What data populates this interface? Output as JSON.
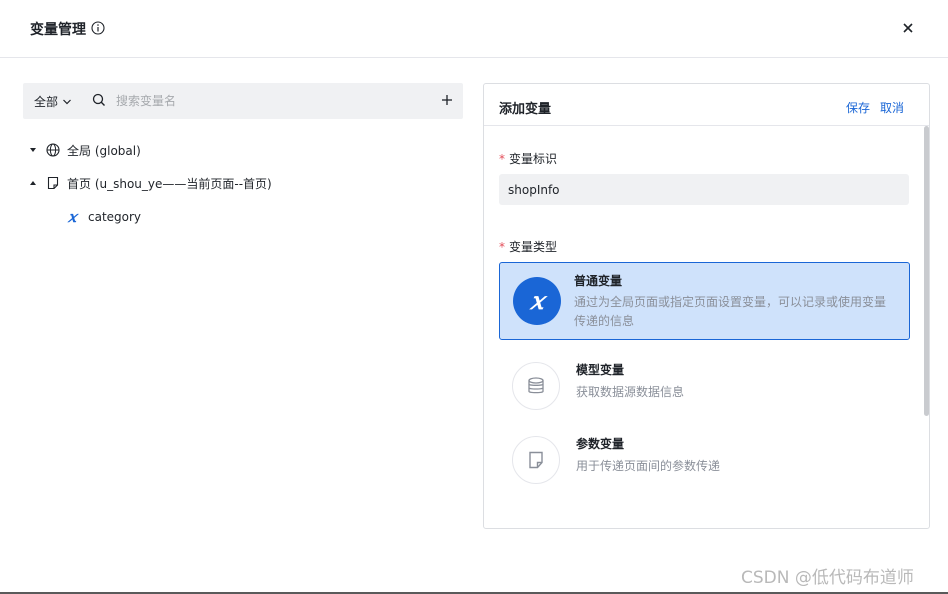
{
  "dialog": {
    "title": "变量管理",
    "info_icon": "info-icon",
    "close_icon": "close-icon"
  },
  "left": {
    "scope_label": "全部",
    "search_placeholder": "搜索变量名",
    "tree": [
      {
        "label": "全局 (global)",
        "icon": "globe-icon",
        "expanded": false
      },
      {
        "label": "首页 (u_shou_ye——当前页面--首页)",
        "icon": "page-icon",
        "expanded": true,
        "children": [
          {
            "label": "category",
            "icon": "variable-x-icon"
          }
        ]
      }
    ]
  },
  "panel": {
    "title": "添加变量",
    "save_label": "保存",
    "cancel_label": "取消",
    "id_label": "变量标识",
    "id_value": "shopInfo",
    "type_label": "变量类型",
    "required_mark": "*",
    "types": [
      {
        "name": "普通变量",
        "desc": "通过为全局页面或指定页面设置变量，可以记录或使用变量传递的信息",
        "icon": "variable-x-icon",
        "selected": true
      },
      {
        "name": "模型变量",
        "desc": "获取数据源数据信息",
        "icon": "database-icon",
        "selected": false
      },
      {
        "name": "参数变量",
        "desc": "用于传递页面间的参数传递",
        "icon": "document-icon",
        "selected": false
      }
    ]
  },
  "watermark": "CSDN @低代码布道师",
  "colors": {
    "accent": "#1a66d6",
    "selected_bg": "#cfe2fb",
    "required": "#e34d59"
  }
}
